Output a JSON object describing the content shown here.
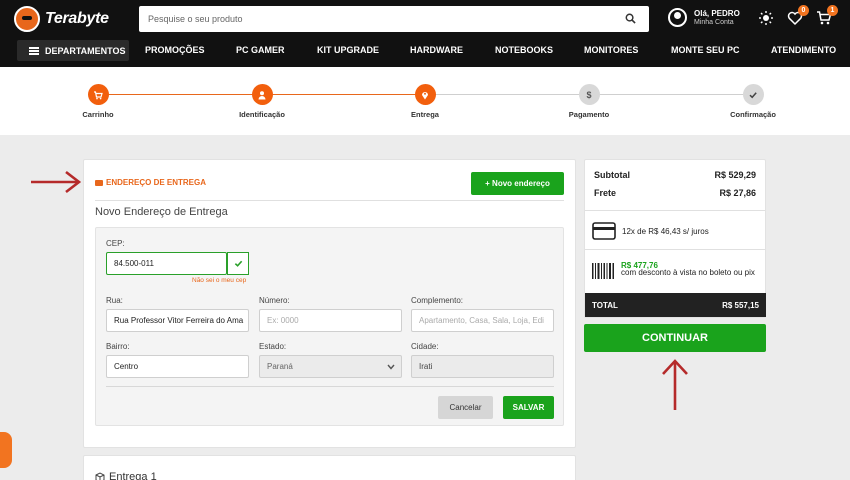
{
  "header": {
    "logo_text": "Terabyte",
    "search_placeholder": "Pesquise o seu produto",
    "account_greeting": "Olá, PEDRO",
    "account_sub": "Minha Conta",
    "favorites_count": "0",
    "cart_count": "1"
  },
  "nav": {
    "departments": "DEPARTAMENTOS",
    "items": [
      "PROMOÇÕES",
      "PC GAMER",
      "KIT UPGRADE",
      "HARDWARE",
      "NOTEBOOKS",
      "MONITORES",
      "MONTE SEU PC",
      "ATENDIMENTO"
    ]
  },
  "steps": [
    {
      "label": "Carrinho",
      "active": true
    },
    {
      "label": "Identificação",
      "active": true
    },
    {
      "label": "Entrega",
      "active": true
    },
    {
      "label": "Pagamento",
      "active": false
    },
    {
      "label": "Confirmação",
      "active": false
    }
  ],
  "address": {
    "section_title": "ENDEREÇO DE ENTREGA",
    "new_address_button": "+ Novo endereço",
    "form_title": "Novo Endereço de Entrega",
    "cep_label": "CEP:",
    "cep_value": "84.500-011",
    "cep_help": "Não sei o meu cep",
    "street_label": "Rua:",
    "street_value": "Rua Professor Vitor Ferreira do Ama",
    "number_label": "Número:",
    "number_placeholder": "Ex: 0000",
    "complement_label": "Complemento:",
    "complement_placeholder": "Apartamento, Casa, Sala, Loja, Edi",
    "district_label": "Bairro:",
    "district_value": "Centro",
    "state_label": "Estado:",
    "state_value": "Paraná",
    "city_label": "Cidade:",
    "city_value": "Irati",
    "cancel_button": "Cancelar",
    "save_button": "SALVAR"
  },
  "delivery": {
    "title": "Entrega 1"
  },
  "summary": {
    "subtotal_label": "Subtotal",
    "subtotal_value": "R$ 529,29",
    "shipping_label": "Frete",
    "shipping_value": "R$ 27,86",
    "installments": "12x de R$ 46,43 s/ juros",
    "boleto_price": "R$ 477,76",
    "boleto_desc": "com desconto à vista no boleto ou pix",
    "total_label": "TOTAL",
    "total_value": "R$ 557,15",
    "continue_button": "CONTINUAR"
  },
  "colors": {
    "accent": "#f25f0d",
    "green": "#1aa31c",
    "header_bg": "#111111",
    "annotation_arrow": "#b52a2a"
  }
}
